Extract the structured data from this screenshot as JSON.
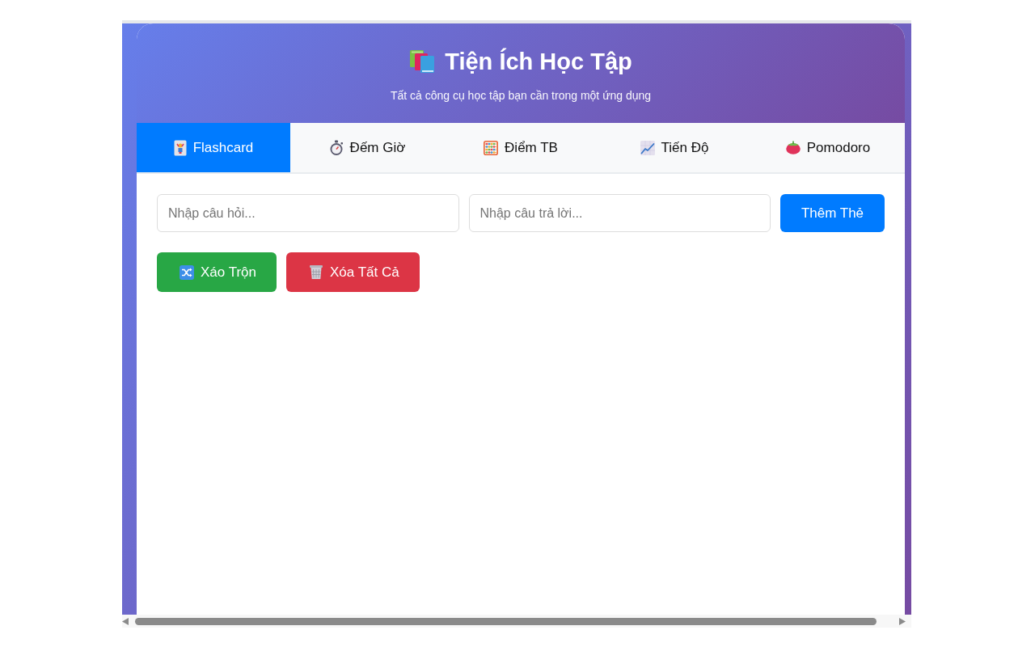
{
  "header": {
    "title": "Tiện Ích Học Tập",
    "subtitle": "Tất cả công cụ học tập bạn cần trong một ứng dụng"
  },
  "tabs": [
    {
      "label": "Flashcard",
      "selected": true
    },
    {
      "label": "Đếm Giờ",
      "selected": false
    },
    {
      "label": "Điểm TB",
      "selected": false
    },
    {
      "label": "Tiến Độ",
      "selected": false
    },
    {
      "label": "Pomodoro",
      "selected": false
    }
  ],
  "flashcard_form": {
    "question": {
      "placeholder": "Nhập câu hỏi..."
    },
    "answer": {
      "placeholder": "Nhập câu trả lời..."
    },
    "add_button": "Thêm Thẻ"
  },
  "actions": [
    {
      "label": "Xáo Trộn",
      "kind": "shuffle"
    },
    {
      "label": "Xóa Tất Cả",
      "kind": "clear"
    }
  ]
}
